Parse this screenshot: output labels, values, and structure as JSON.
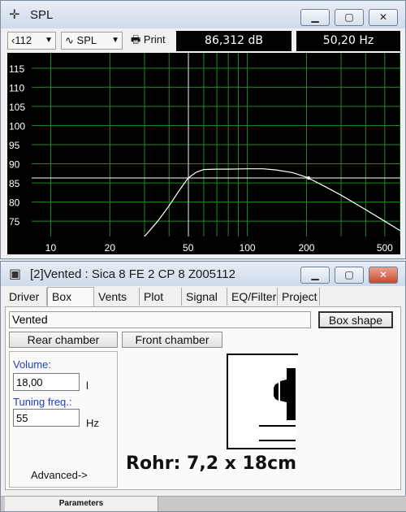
{
  "spl_window": {
    "title": "SPL",
    "toolbar": {
      "curve_selector": "‹112",
      "spl_dropdown": "SPL",
      "print_label": "Print",
      "readout_db": "86,312 dB",
      "readout_hz": "50,20 Hz"
    },
    "chart_data": {
      "type": "line",
      "xscale": "log",
      "x_ticks": [
        10,
        20,
        50,
        100,
        200,
        500
      ],
      "y_ticks": [
        75,
        80,
        85,
        90,
        95,
        100,
        105,
        110,
        115
      ],
      "xlim": [
        8,
        600
      ],
      "ylim": [
        71,
        119
      ],
      "cursor_x": 50.2,
      "reference_level": 86.3,
      "grid": true,
      "series": [
        {
          "x": [
            30,
            35,
            40,
            45,
            50,
            55,
            60,
            70,
            80,
            100,
            120,
            140,
            170,
            200,
            250,
            300,
            400,
            500,
            600
          ],
          "y": [
            71,
            75,
            79,
            83,
            86.3,
            87.8,
            88.5,
            88.6,
            88.6,
            88.7,
            88.7,
            88.4,
            87.7,
            86.5,
            84.0,
            81.8,
            78.0,
            75.0,
            72.5
          ]
        }
      ]
    }
  },
  "box_window": {
    "title": "[2]Vented : Sica 8 FE 2 CP 8 Z005112",
    "tabs": [
      "Driver",
      "Box",
      "Vents",
      "Plot",
      "Signal",
      "EQ/Filter",
      "Project"
    ],
    "active_tab": "Box",
    "box_type": "Vented",
    "box_shape_button": "Box shape",
    "rear_chamber_button": "Rear chamber",
    "front_chamber_button": "Front chamber",
    "volume_label": "Volume:",
    "volume_value": "18,00",
    "volume_unit": "l",
    "tuning_label": "Tuning freq.:",
    "tuning_value": "55",
    "tuning_unit": "Hz",
    "advanced_button": "Advanced->",
    "annotation": "Rohr: 7,2 x 18cm",
    "status_tab": "Parameters"
  }
}
